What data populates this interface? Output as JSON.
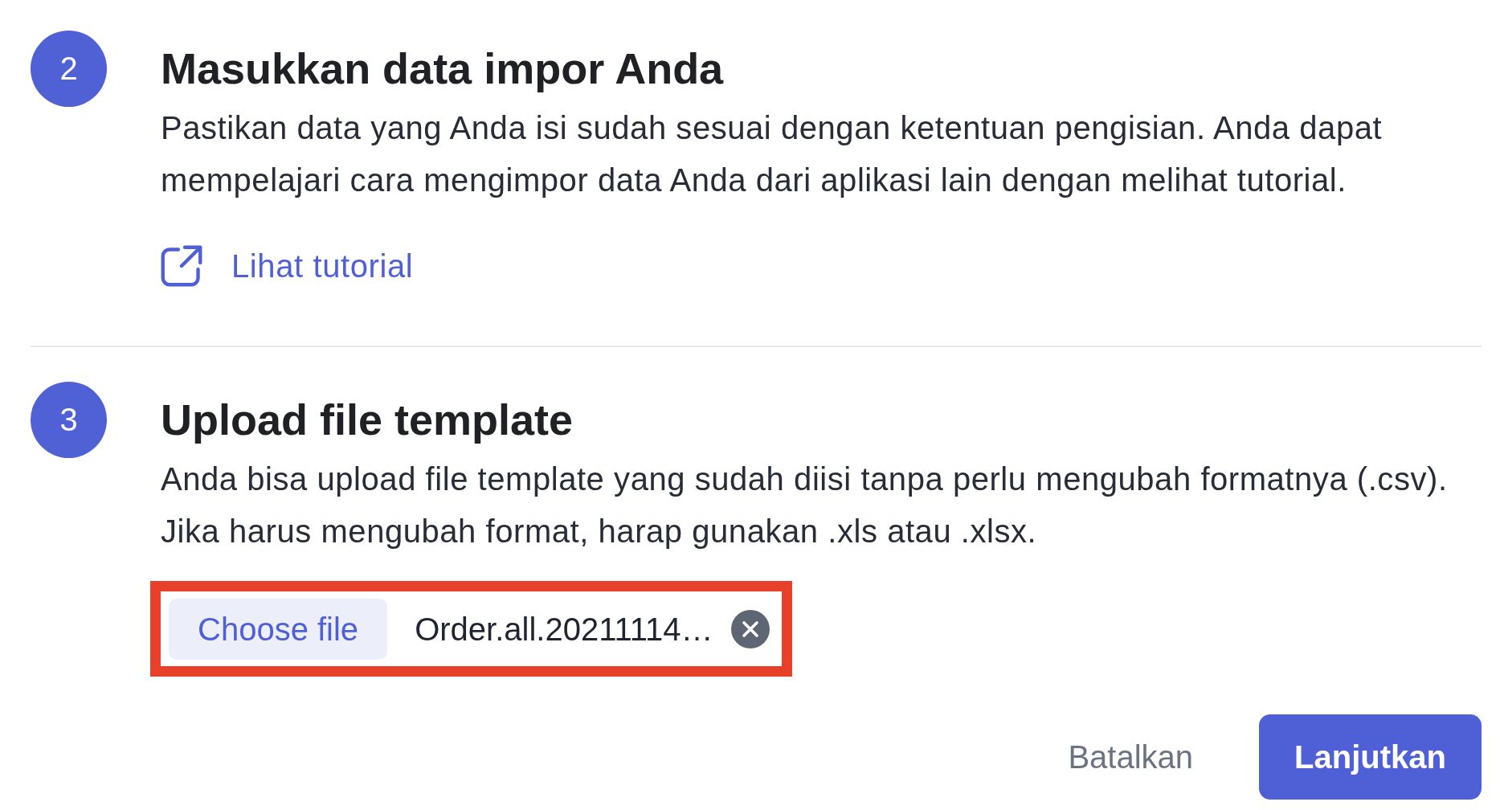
{
  "steps": [
    {
      "number": "2",
      "title": "Masukkan data impor Anda",
      "description": "Pastikan data yang Anda isi sudah sesuai dengan ketentuan pengisian. Anda dapat mempelajari cara mengimpor data Anda dari aplikasi lain dengan melihat tutorial.",
      "link": {
        "label": "Lihat tutorial"
      }
    },
    {
      "number": "3",
      "title": "Upload file template",
      "description": "Anda bisa upload file template yang sudah diisi tanpa perlu mengubah formatnya (.csv). Jika harus mengubah format, harap gunakan .xls atau .xlsx.",
      "file_input": {
        "button_label": "Choose file",
        "file_name": "Order.all.20211114…",
        "highlighted": true
      }
    }
  ],
  "actions": [
    {
      "label": "Batalkan",
      "kind": "secondary"
    },
    {
      "label": "Lanjutkan",
      "kind": "primary"
    }
  ]
}
